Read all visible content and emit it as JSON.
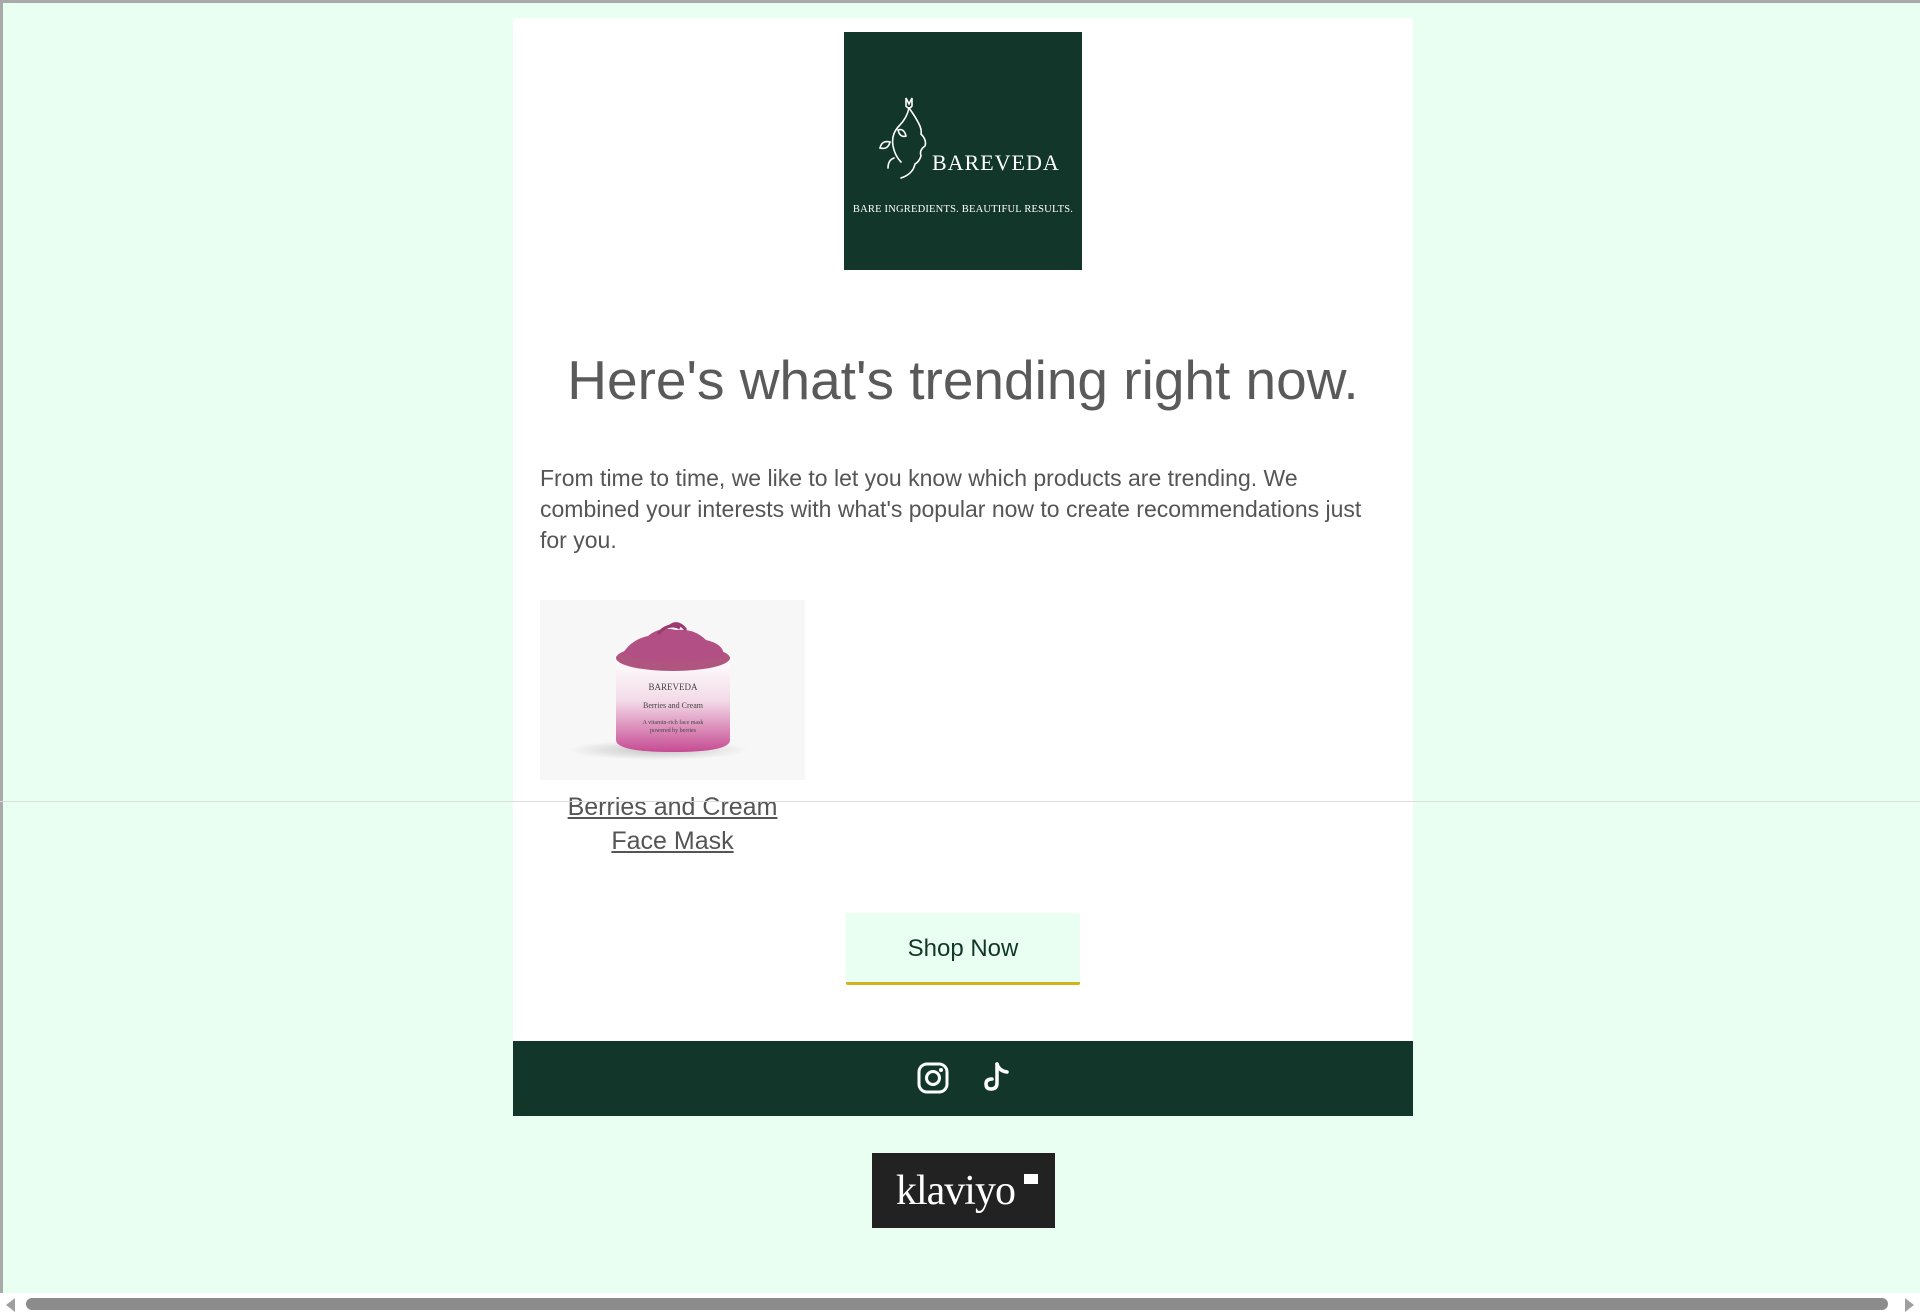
{
  "logo": {
    "brand": "BAREVEDA",
    "tagline": "BARE INGREDIENTS. BEAUTIFUL RESULTS.",
    "background": "#12372a"
  },
  "headline": "Here's what's trending right now.",
  "intro": "From time to time, we like to let you know which products are trending. We combined your interests with what's popular now to create recommendations just for you.",
  "product": {
    "name": "Berries and Cream Face Mask",
    "jar_brand": "BAREVEDA",
    "jar_name": "Berries and Cream",
    "jar_desc_line1": "A vitamin-rich face mask",
    "jar_desc_line2": "powered by berries"
  },
  "cta": {
    "label": "Shop Now"
  },
  "social": {
    "icons": [
      "instagram-icon",
      "tiktok-icon"
    ]
  },
  "footer": {
    "badge": "klaviyo"
  },
  "colors": {
    "page_bg": "#e8fff2",
    "brand_green": "#12372a",
    "button_bg": "#e8fff2",
    "button_border": "#d4b21a",
    "text_gray": "#555555"
  }
}
